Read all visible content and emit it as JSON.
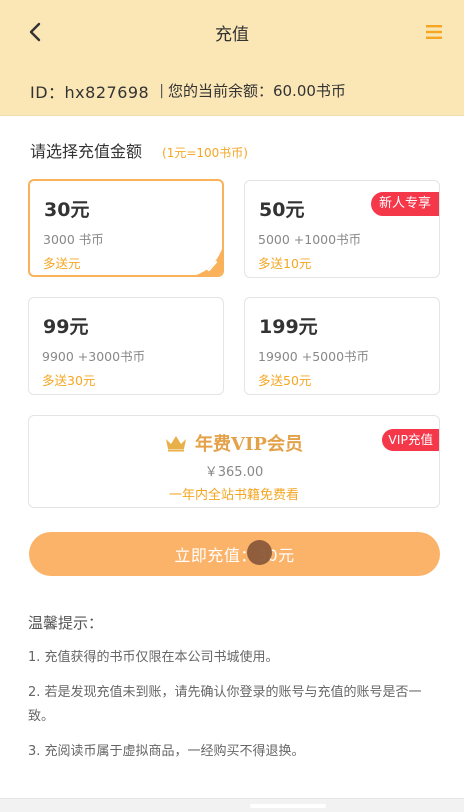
{
  "header": {
    "title": "充值"
  },
  "balance": {
    "id_text": "ID：hx827698",
    "separator": "|",
    "label": "您的当前余额：",
    "value": "60.00书币"
  },
  "section": {
    "title": "请选择充值金额",
    "rate": "(1元=100书币)"
  },
  "options": [
    {
      "amount": "30元",
      "coins": "3000 书币",
      "bonus": "多送元",
      "selected": true
    },
    {
      "amount": "50元",
      "coins": "5000 +1000书币",
      "bonus": "多送10元",
      "tag": "新人专享"
    },
    {
      "amount": "99元",
      "coins": "9900 +3000书币",
      "bonus": "多送30元"
    },
    {
      "amount": "199元",
      "coins": "19900 +5000书币",
      "bonus": "多送50元"
    }
  ],
  "vip": {
    "title": "年费VIP会员",
    "price": "￥365.00",
    "desc": "一年内全站书籍免费看",
    "tag": "VIP充值"
  },
  "pay": {
    "label": "立即充值：30元"
  },
  "tips": {
    "title": "温馨提示：",
    "items": [
      "1. 充值获得的书币仅限在本公司书城使用。",
      "2. 若是发现充值未到账，请先确认你登录的账号与充值的账号是否一致。",
      "3. 充阅读币属于虚拟商品，一经购买不得退换。"
    ]
  },
  "colors": {
    "header_bg": "#fbe6b6",
    "accent": "#f5a623",
    "selected_border": "#f9b25a",
    "tag_red": "#f5374a",
    "button": "#fbb36a"
  }
}
